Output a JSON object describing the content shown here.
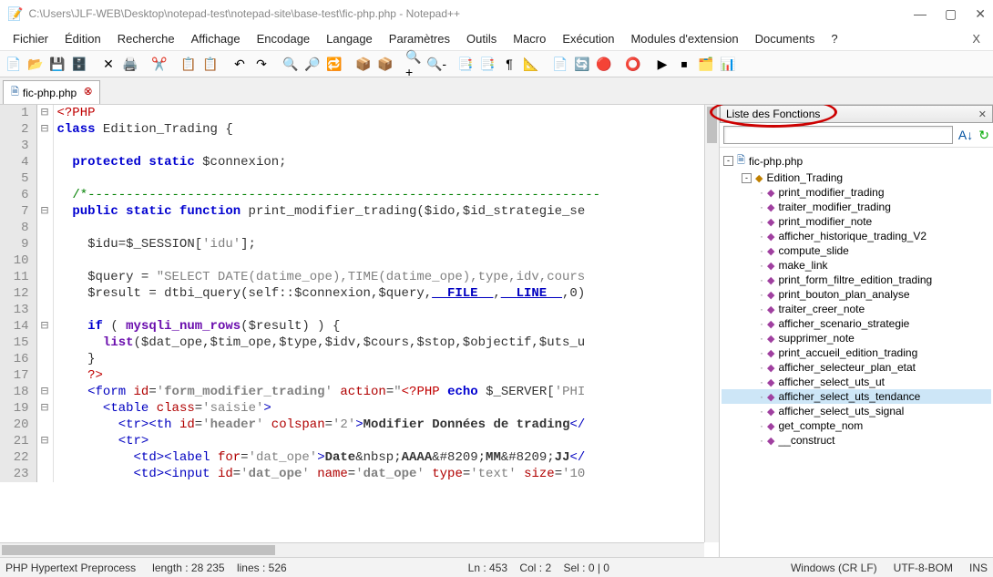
{
  "title": "C:\\Users\\JLF-WEB\\Desktop\\notepad-test\\notepad-site\\base-test\\fic-php.php - Notepad++",
  "menus": [
    "Fichier",
    "Édition",
    "Recherche",
    "Affichage",
    "Encodage",
    "Langage",
    "Paramètres",
    "Outils",
    "Macro",
    "Exécution",
    "Modules d'extension",
    "Documents",
    "?"
  ],
  "toolbar_icons": [
    "📄",
    "📂",
    "💾",
    "🗄️",
    "✕",
    "🖨️",
    "✂️",
    "📋",
    "📋",
    "↶",
    "↷",
    "🔍",
    "🔎",
    "🔁",
    "📦",
    "📦",
    "🔍+",
    "🔍-",
    "📑",
    "📑",
    "¶",
    "📐",
    "📄",
    "🔄",
    "🔴",
    "⭕",
    "▶",
    "⏹",
    "🗂️",
    "📊"
  ],
  "tab": {
    "name": "fic-php.php"
  },
  "code": {
    "lines": [
      {
        "num": 1,
        "fold": "-",
        "html": "<span class='tagred'>&lt;?PHP</span>"
      },
      {
        "num": 2,
        "fold": "-",
        "html": "<span class='kw'>class</span> Edition_Trading {"
      },
      {
        "num": 3,
        "fold": "",
        "html": ""
      },
      {
        "num": 4,
        "fold": "",
        "html": "  <span class='kw'>protected static</span> $connexion;"
      },
      {
        "num": 5,
        "fold": "",
        "html": ""
      },
      {
        "num": 6,
        "fold": "",
        "html": "  <span class='cmt'>/*-------------------------------------------------------------------</span>"
      },
      {
        "num": 7,
        "fold": "-",
        "html": "  <span class='kw'>public static function</span> print_modifier_trading($ido,$id_strategie_se"
      },
      {
        "num": 8,
        "fold": "",
        "html": ""
      },
      {
        "num": 9,
        "fold": "",
        "html": "    $idu=$_SESSION[<span class='str'>'idu'</span>];"
      },
      {
        "num": 10,
        "fold": "",
        "html": ""
      },
      {
        "num": 11,
        "fold": "",
        "html": "    $query = <span class='str'>\"SELECT DATE(datime_ope),TIME(datime_ope),type,idv,cours</span>"
      },
      {
        "num": 12,
        "fold": "",
        "html": "    $result = dtbi_query(self::$connexion,$query,<span class='magic'>__FILE__</span>,<span class='magic'>__LINE__</span>,0)"
      },
      {
        "num": 13,
        "fold": "",
        "html": ""
      },
      {
        "num": 14,
        "fold": "-",
        "html": "    <span class='kw'>if</span> ( <span class='kw2'>mysqli_num_rows</span>($result) ) {"
      },
      {
        "num": 15,
        "fold": "",
        "html": "      <span class='kw2'>list</span>($dat_ope,$tim_ope,$type,$idv,$cours,$stop,$objectif,$uts_u"
      },
      {
        "num": 16,
        "fold": "",
        "html": "    }"
      },
      {
        "num": 17,
        "fold": "",
        "html": "    <span class='tagred'>?&gt;</span>"
      },
      {
        "num": 18,
        "fold": "-",
        "html": "    <span class='tagblue'>&lt;form</span> <span class='attr'>id</span>=<span class='str'>'<b>form_modifier_trading</b>'</span> <span class='attr'>action</span>=<span class='str'>\"</span><span class='tagred'>&lt;?PHP</span> <span class='kw'>echo</span> $_SERVER[<span class='str'>'PHI</span>"
      },
      {
        "num": 19,
        "fold": "-",
        "html": "      <span class='tagblue'>&lt;table</span> <span class='attr'>class</span>=<span class='str'>'saisie'</span><span class='tagblue'>&gt;</span>"
      },
      {
        "num": 20,
        "fold": "",
        "html": "        <span class='tagblue'>&lt;tr&gt;&lt;th</span> <span class='attr'>id</span>=<span class='str'>'<b>header</b>'</span> <span class='attr'>colspan</span>=<span class='str'>'2'</span><span class='tagblue'>&gt;</span><b>Modifier Données de trading</b><span class='tagblue'>&lt;/</span>"
      },
      {
        "num": 21,
        "fold": "-",
        "html": "        <span class='tagblue'>&lt;tr&gt;</span>"
      },
      {
        "num": 22,
        "fold": "",
        "html": "          <span class='tagblue'>&lt;td&gt;&lt;label</span> <span class='attr'>for</span>=<span class='str'>'dat_ope'</span><span class='tagblue'>&gt;</span><b>Date</b>&amp;nbsp;<b>AAAA</b>&amp;#8209;<b>MM</b>&amp;#8209;<b>JJ</b><span class='tagblue'>&lt;/</span>"
      },
      {
        "num": 23,
        "fold": "",
        "html": "          <span class='tagblue'>&lt;td&gt;&lt;input</span> <span class='attr'>id</span>=<span class='str'>'<b>dat_ope</b>'</span> <span class='attr'>name</span>=<span class='str'>'<b>dat_ope</b>'</span> <span class='attr'>type</span>=<span class='str'>'text'</span> <span class='attr'>size</span>=<span class='str'>'10</span>"
      }
    ]
  },
  "side_panel": {
    "title": "Liste des Fonctions",
    "search_placeholder": "",
    "tree": {
      "file": "fic-php.php",
      "class": "Edition_Trading",
      "functions": [
        "print_modifier_trading",
        "traiter_modifier_trading",
        "print_modifier_note",
        "afficher_historique_trading_V2",
        "compute_slide",
        "make_link",
        "print_form_filtre_edition_trading",
        "print_bouton_plan_analyse",
        "traiter_creer_note",
        "afficher_scenario_strategie",
        "supprimer_note",
        "print_accueil_edition_trading",
        "afficher_selecteur_plan_etat",
        "afficher_select_uts_ut",
        "afficher_select_uts_tendance",
        "afficher_select_uts_signal",
        "get_compte_nom",
        "__construct"
      ],
      "selected_index": 14
    }
  },
  "status": {
    "lang": "PHP Hypertext Preprocess",
    "length_label": "length :",
    "length": "28 235",
    "lines_label": "lines :",
    "lines": "526",
    "ln_label": "Ln :",
    "ln": "453",
    "col_label": "Col :",
    "col": "2",
    "sel_label": "Sel :",
    "sel": "0 | 0",
    "eol": "Windows (CR LF)",
    "enc": "UTF-8-BOM",
    "mode": "INS"
  }
}
